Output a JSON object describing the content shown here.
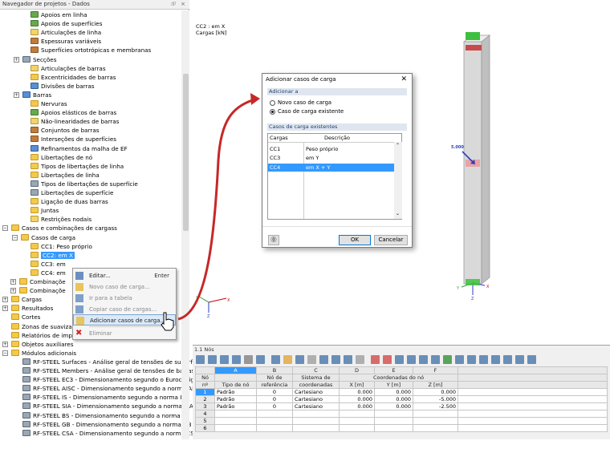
{
  "navigator": {
    "title": "Navegador de projetos - Dados",
    "pin": "⮺",
    "close": "×",
    "items": [
      {
        "label": "Apoios em linha",
        "icon": "green"
      },
      {
        "label": "Apoios de superfícies",
        "icon": "green"
      },
      {
        "label": "Articulações de linha",
        "icon": "yellow"
      },
      {
        "label": "Espessuras variáveis",
        "icon": "brown"
      },
      {
        "label": "Superfícies ortotrópicas e membranas",
        "icon": "brown"
      },
      {
        "label": "Secções",
        "icon": "gray"
      },
      {
        "label": "Articulações de barras",
        "icon": "yellow"
      },
      {
        "label": "Excentricidades de barras",
        "icon": "folder"
      },
      {
        "label": "Divisões de barras",
        "icon": "blue"
      },
      {
        "label": "Barras",
        "icon": "blue"
      },
      {
        "label": "Nervuras",
        "icon": "folder"
      },
      {
        "label": "Apoios elásticos de barras",
        "icon": "green"
      },
      {
        "label": "Não-linearidades de barras",
        "icon": "yellow"
      },
      {
        "label": "Conjuntos de barras",
        "icon": "brown"
      },
      {
        "label": "Interseções de superfícies",
        "icon": "brown"
      },
      {
        "label": "Refinamentos da malha de EF",
        "icon": "blue"
      },
      {
        "label": "Libertações de nó",
        "icon": "folder"
      },
      {
        "label": "Tipos de libertações de linha",
        "icon": "folder"
      },
      {
        "label": "Libertações de linha",
        "icon": "folder"
      },
      {
        "label": "Tipos de libertações de superfície",
        "icon": "gray"
      },
      {
        "label": "Libertações de superfície",
        "icon": "gray"
      },
      {
        "label": "Ligação de duas barras",
        "icon": "folder"
      },
      {
        "label": "Juntas",
        "icon": "folder"
      },
      {
        "label": "Restrições nodais",
        "icon": "yellow"
      },
      {
        "label": "Casos e combinações de cargass",
        "icon": "folder"
      },
      {
        "label": "Casos de carga",
        "icon": "folder"
      },
      {
        "label": "CC1: Peso próprio",
        "icon": "folder"
      },
      {
        "label": "CC2: em X",
        "icon": "folder"
      },
      {
        "label": "CC3: em",
        "icon": "folder"
      },
      {
        "label": "CC4: em",
        "icon": "folder"
      },
      {
        "label": "Combinaçõe",
        "icon": "folder"
      },
      {
        "label": "Combinaçõe",
        "icon": "folder"
      },
      {
        "label": "Cargas",
        "icon": "folder"
      },
      {
        "label": "Resultados",
        "icon": "folder"
      },
      {
        "label": "Cortes",
        "icon": "folder"
      },
      {
        "label": "Zonas de suavizaçã",
        "icon": "folder"
      },
      {
        "label": "Relatórios de impressão",
        "icon": "folder"
      },
      {
        "label": "Objetos auxiliares",
        "icon": "folder"
      },
      {
        "label": "Módulos adicionais",
        "icon": "folder"
      },
      {
        "label": "RF-STEEL Surfaces - Análise geral de tensões de superfíci",
        "icon": "gray"
      },
      {
        "label": "RF-STEEL Members - Análise geral de tensões de barras e",
        "icon": "gray"
      },
      {
        "label": "RF-STEEL EC3 - Dimensionamento segundo o Eurocódig",
        "icon": "gray"
      },
      {
        "label": "RF-STEEL AISC - Dimensionamento segundo a norma AI",
        "icon": "gray"
      },
      {
        "label": "RF-STEEL IS - Dimensionamento segundo a norma IS",
        "icon": "gray"
      },
      {
        "label": "RF-STEEL SIA - Dimensionamento segundo a norma SIA",
        "icon": "gray"
      },
      {
        "label": "RF-STEEL BS - Dimensionamento segundo a norma BS",
        "icon": "gray"
      },
      {
        "label": "RF-STEEL GB - Dimensionamento segundo a norma GB",
        "icon": "gray"
      },
      {
        "label": "RF-STEEL CSA - Dimensionamento segundo a norma CSA",
        "icon": "gray"
      }
    ]
  },
  "context_menu": {
    "items": [
      {
        "label": "Editar...",
        "shortcut": "Enter",
        "enabled": true
      },
      {
        "label": "Novo caso de carga...",
        "shortcut": "",
        "enabled": false
      },
      {
        "label": "Ir para a tabela",
        "shortcut": "",
        "enabled": false
      },
      {
        "label": "Copiar caso de cargas...",
        "shortcut": "",
        "enabled": false
      },
      {
        "label": "Adicionar casos de carga...",
        "shortcut": "",
        "enabled": true,
        "highlighted": true
      },
      {
        "label": "Eliminar",
        "shortcut": "",
        "enabled": false
      }
    ]
  },
  "view": {
    "info_line1": "CC2 : em X",
    "info_line2": "Cargas [kN]",
    "load_value": "5.000",
    "axis_x": "X",
    "axis_y": "Y",
    "axis_z": "Z"
  },
  "dialog": {
    "title": "Adicionar casos de carga",
    "close": "✕",
    "add_group": "Adicionar a",
    "option_new": "Novo caso de carga",
    "option_existing": "Caso de carga existente",
    "existing_group": "Casos de carga existentes",
    "col_loads": "Cargas",
    "col_desc": "Descrição",
    "rows": [
      {
        "id": "CC1",
        "desc": "Peso próprio"
      },
      {
        "id": "CC3",
        "desc": "em Y"
      },
      {
        "id": "CC4",
        "desc": "em X + Y"
      }
    ],
    "ok": "OK",
    "cancel": "Cancelar"
  },
  "table": {
    "title": "1.1 Nós",
    "columns": {
      "a": "A",
      "b": "B",
      "c": "C",
      "d": "D",
      "e": "E",
      "f": "F",
      "no": "Nó",
      "no2": "nº",
      "tipo": "Tipo de nó",
      "ref1": "Nó de",
      "ref2": "referência",
      "sis1": "Sistema de",
      "sis2": "coordenadas",
      "coords": "Coordenadas do nó",
      "x": "X [m]",
      "y": "Y [m]",
      "z": "Z [m]"
    },
    "rows": [
      {
        "n": "1",
        "tipo": "Padrão",
        "ref": "0",
        "sis": "Cartesiano",
        "x": "0.000",
        "y": "0.000",
        "z": "0.000"
      },
      {
        "n": "2",
        "tipo": "Padrão",
        "ref": "0",
        "sis": "Cartesiano",
        "x": "0.000",
        "y": "0.000",
        "z": "-5.000"
      },
      {
        "n": "3",
        "tipo": "Padrão",
        "ref": "0",
        "sis": "Cartesiano",
        "x": "0.000",
        "y": "0.000",
        "z": "-2.500"
      },
      {
        "n": "4",
        "tipo": "",
        "ref": "",
        "sis": "",
        "x": "",
        "y": "",
        "z": ""
      },
      {
        "n": "5",
        "tipo": "",
        "ref": "",
        "sis": "",
        "x": "",
        "y": "",
        "z": ""
      },
      {
        "n": "6",
        "tipo": "",
        "ref": "",
        "sis": "",
        "x": "",
        "y": "",
        "z": ""
      }
    ]
  }
}
